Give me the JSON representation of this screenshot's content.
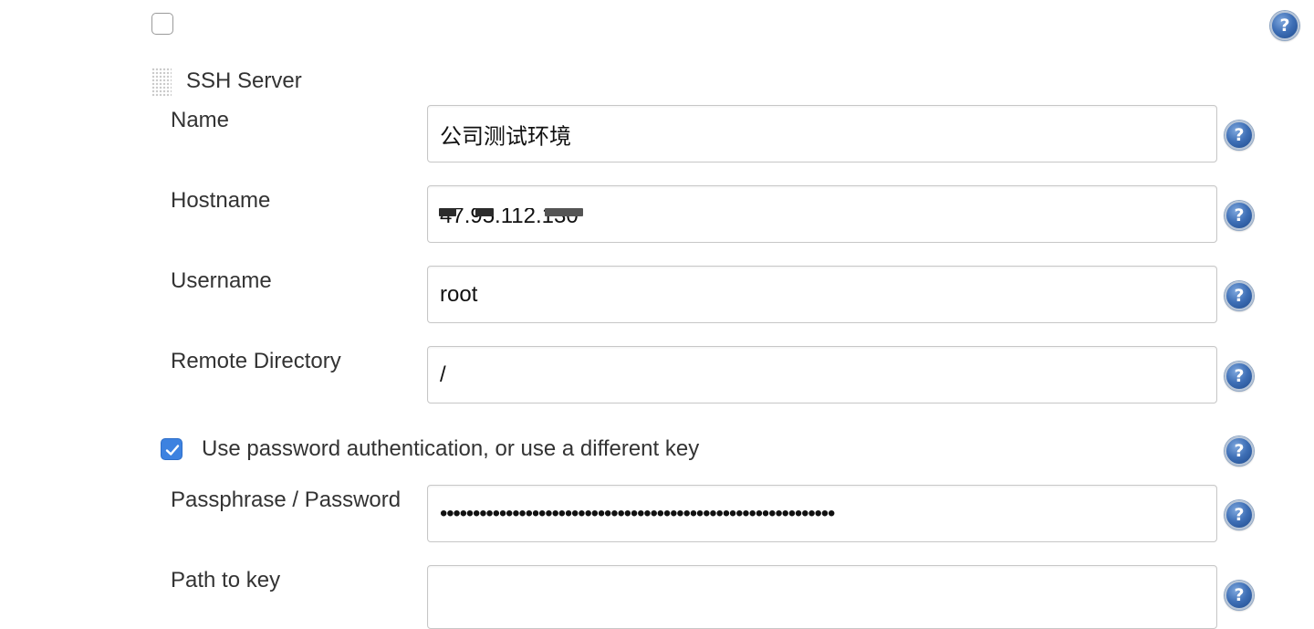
{
  "enable_checkbox": {
    "checked": false
  },
  "ssh_server": {
    "title": "SSH Server",
    "fields": {
      "name": {
        "label": "Name",
        "value": "公司测试环境"
      },
      "hostname": {
        "label": "Hostname",
        "value": "47.95.112.130"
      },
      "username": {
        "label": "Username",
        "value": "root"
      },
      "remote_directory": {
        "label": "Remote Directory",
        "value": "/"
      },
      "passphrase": {
        "label": "Passphrase / Password",
        "value": "••••••••••••••••••••••••••••••••••••••••••••••••••••••••••••"
      },
      "path_to_key": {
        "label": "Path to key",
        "value": ""
      }
    },
    "password_auth": {
      "label": "Use password authentication, or use a different key",
      "checked": true
    }
  },
  "help_icon_glyph": "?",
  "colors": {
    "accent": "#3d82e0",
    "help_icon": "#3e6fb6",
    "text": "#333333",
    "input_border": "#c7c7c7"
  },
  "icons": [
    "help-icon",
    "drag-handle-icon",
    "checkmark-icon"
  ]
}
